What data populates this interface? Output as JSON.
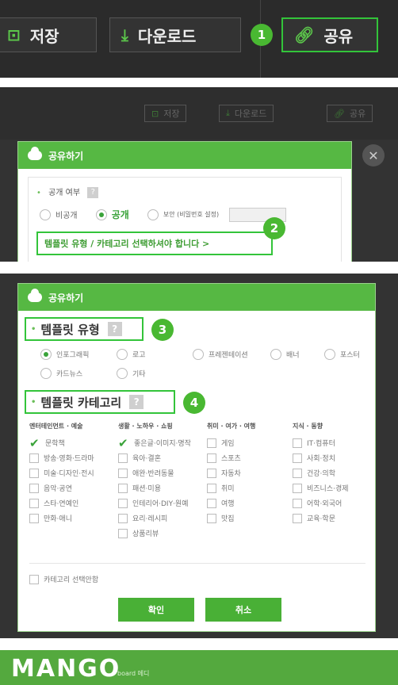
{
  "panel1": {
    "save_label": "저장",
    "download_label": "다운로드",
    "share_label": "공유",
    "step": "1"
  },
  "panel2": {
    "save_label": "저장",
    "download_label": "다운로드",
    "share_label": "공유",
    "dialog_title": "공유하기",
    "visibility_label": "공개 여부",
    "help": "?",
    "options": [
      "비공개",
      "공개",
      "보안 (비밀번호 설정)"
    ],
    "selected_option": "공개",
    "notice": "템플릿 유형 / 카테고리 선택하셔야 합니다 >",
    "step": "2"
  },
  "panel3": {
    "dialog_title": "공유하기",
    "type_heading": "템플릿 유형",
    "type_step": "3",
    "types": [
      "인포그래픽",
      "로고",
      "프레젠테이션",
      "배너",
      "포스터",
      "카드뉴스",
      "기타"
    ],
    "selected_type": "인포그래픽",
    "cat_heading": "템플릿 카테고리",
    "cat_step": "4",
    "help": "?",
    "columns": [
      {
        "header": "엔터테인먼트 · 예술",
        "items": [
          "문학책",
          "방송·영화·드라마",
          "미술·디자인·전시",
          "음악·공연",
          "스타·연예인",
          "만화·애니"
        ],
        "checked": [
          0
        ]
      },
      {
        "header": "생활 · 노하우 · 쇼핑",
        "items": [
          "좋은글·이미지·명작",
          "육아·결혼",
          "애완·반려동물",
          "패션·미용",
          "인테리어·DIY·원예",
          "요리·레시피",
          "상품리뷰"
        ],
        "checked": [
          0
        ]
      },
      {
        "header": "취미 · 여가 · 여행",
        "items": [
          "게임",
          "스포츠",
          "자동차",
          "취미",
          "여행",
          "맛집"
        ],
        "checked": []
      },
      {
        "header": "지식 · 동향",
        "items": [
          "IT·컴퓨터",
          "사회·정치",
          "건강·의학",
          "비즈니스·경제",
          "어학·외국어",
          "교육·학문"
        ],
        "checked": []
      }
    ],
    "no_category": "카테고리 선택안함",
    "confirm_label": "확인",
    "cancel_label": "취소"
  },
  "panel4": {
    "logo": "MANGO",
    "sub": "board 메디"
  },
  "colors": {
    "accent": "#49b836",
    "highlight_border": "#33c43a",
    "dark_bg": "#2b2b2b"
  }
}
